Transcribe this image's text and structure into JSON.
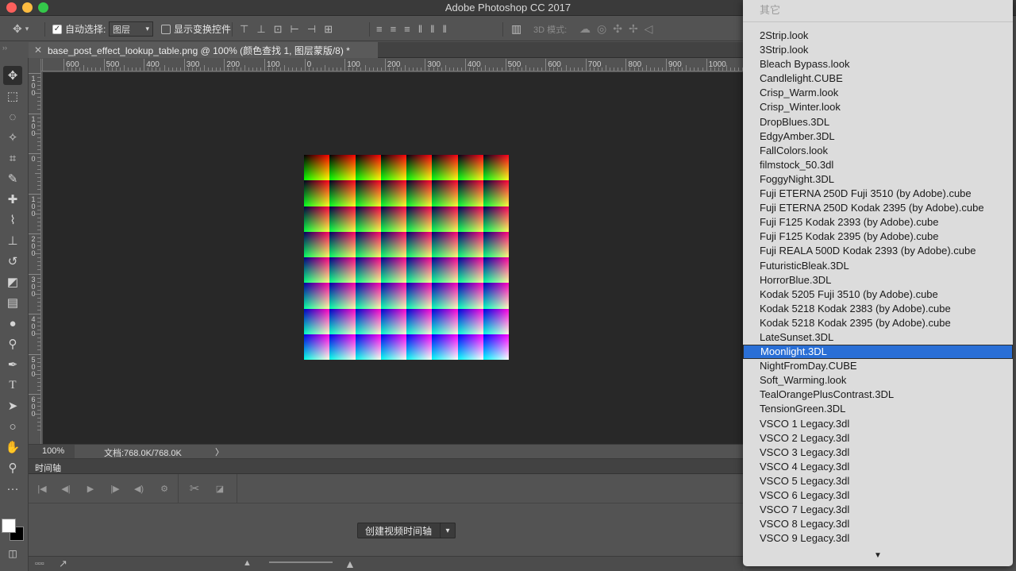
{
  "app": {
    "title": "Adobe Photoshop CC 2017"
  },
  "options_bar": {
    "auto_select_label": "自动选择:",
    "auto_select_checked": true,
    "auto_select_target": "图层",
    "show_transform_label": "显示变换控件",
    "show_transform_checked": false,
    "mode_3d_label": "3D 模式:"
  },
  "document": {
    "tab_title": "base_post_effect_lookup_table.png @ 100% (颜色查找 1, 图层蒙版/8) *",
    "ruler_h_labels": [
      "600",
      "500",
      "400",
      "300",
      "200",
      "100",
      "0",
      "100",
      "200",
      "300",
      "400",
      "500",
      "600",
      "700",
      "800",
      "900",
      "1000"
    ],
    "ruler_v_labels": [
      "1\n0\n0",
      "1\n0\n0",
      "0",
      "1\n0\n0",
      "2\n0\n0",
      "3\n0\n0",
      "4\n0\n0",
      "5\n0\n0",
      "6\n0\n0"
    ]
  },
  "status_bar": {
    "zoom": "100%",
    "doc_info": "文档:768.0K/768.0K",
    "arrow": "〉"
  },
  "timeline": {
    "tab_label": "时间轴",
    "create_button": "创建视频时间轴"
  },
  "lookup_menu": {
    "header": "其它",
    "items": [
      "2Strip.look",
      "3Strip.look",
      "Bleach Bypass.look",
      "Candlelight.CUBE",
      "Crisp_Warm.look",
      "Crisp_Winter.look",
      "DropBlues.3DL",
      "EdgyAmber.3DL",
      "FallColors.look",
      "filmstock_50.3dl",
      "FoggyNight.3DL",
      "Fuji ETERNA 250D Fuji 3510 (by Adobe).cube",
      "Fuji ETERNA 250D Kodak 2395 (by Adobe).cube",
      "Fuji F125 Kodak 2393 (by Adobe).cube",
      "Fuji F125 Kodak 2395 (by Adobe).cube",
      "Fuji REALA 500D Kodak 2393 (by Adobe).cube",
      "FuturisticBleak.3DL",
      "HorrorBlue.3DL",
      "Kodak 5205 Fuji 3510 (by Adobe).cube",
      "Kodak 5218 Kodak 2383 (by Adobe).cube",
      "Kodak 5218 Kodak 2395 (by Adobe).cube",
      "LateSunset.3DL",
      "Moonlight.3DL",
      "NightFromDay.CUBE",
      "Soft_Warming.look",
      "TealOrangePlusContrast.3DL",
      "TensionGreen.3DL",
      "VSCO 1 Legacy.3dl",
      "VSCO 2 Legacy.3dl",
      "VSCO 3 Legacy.3dl",
      "VSCO 4 Legacy.3dl",
      "VSCO 5 Legacy.3dl",
      "VSCO 6 Legacy.3dl",
      "VSCO 7 Legacy.3dl",
      "VSCO 8 Legacy.3dl",
      "VSCO 9 Legacy.3dl"
    ],
    "selected": "Moonlight.3DL",
    "more_indicator": "▼"
  },
  "colors": {
    "menu_highlight": "#2a6fd6",
    "canvas_bg": "#282828",
    "ui_bg": "#535353"
  }
}
